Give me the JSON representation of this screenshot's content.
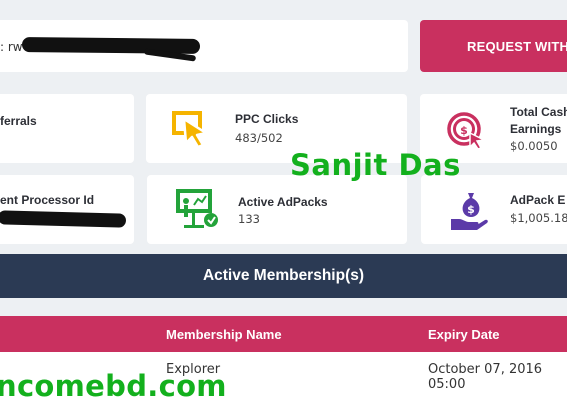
{
  "referral": {
    "prefix": ": rw"
  },
  "request_button": {
    "label": "REQUEST WITH"
  },
  "stats": {
    "referrals": {
      "label": "ferrals"
    },
    "ppc_clicks": {
      "label": "PPC Clicks",
      "value": "483/502"
    },
    "total_cash": {
      "label_line1": "Total Cash",
      "label_line2": "Earnings",
      "value": "$0.0050"
    },
    "processor": {
      "label": "ent Processor Id"
    },
    "active_adpacks": {
      "label": "Active AdPacks",
      "value": "133"
    },
    "adpack_earnings": {
      "label": "AdPack E",
      "value": "$1,005.18"
    }
  },
  "watermarks": {
    "name": "Sanjit Das",
    "site": "ncomebd.com"
  },
  "membership": {
    "title": "Active Membership(s)",
    "columns": {
      "name": "Membership Name",
      "expiry": "Expiry Date"
    },
    "rows": [
      {
        "name": "Explorer",
        "expiry": "October 07, 2016 05:00"
      }
    ]
  },
  "colors": {
    "accent": "#c9305f",
    "navy": "#2b3a54",
    "icon_yellow": "#f5b400",
    "icon_green": "#23a33a",
    "watermark": "#13b01d"
  }
}
